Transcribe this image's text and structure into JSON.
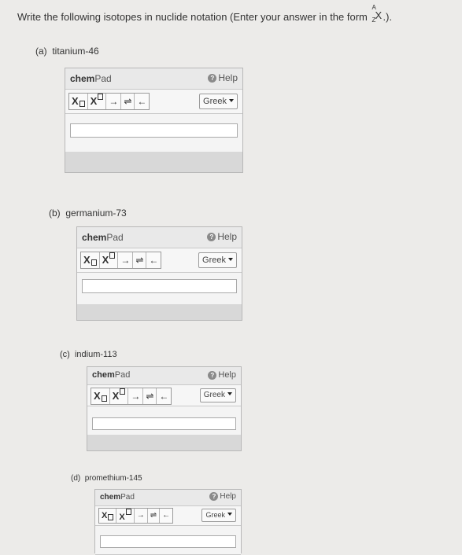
{
  "question": {
    "text": "Write the following isotopes in nuclide notation (Enter your answer in the form ",
    "nuclide": {
      "a": "A",
      "z": "Z",
      "x": "X"
    },
    "end": ".)."
  },
  "chempad_common": {
    "title_bold": "chem",
    "title_rest": "Pad",
    "help": "Help",
    "help_icon": "?",
    "tools": {
      "sub": "X",
      "sup": "X",
      "right": "→",
      "equil": "⇌",
      "left": "←"
    },
    "greek": "Greek"
  },
  "parts": [
    {
      "label": "(a)",
      "element": "titanium-46"
    },
    {
      "label": "(b)",
      "element": "germanium-73"
    },
    {
      "label": "(c)",
      "element": "indium-113"
    },
    {
      "label": "(d)",
      "element": "promethium-145"
    }
  ]
}
